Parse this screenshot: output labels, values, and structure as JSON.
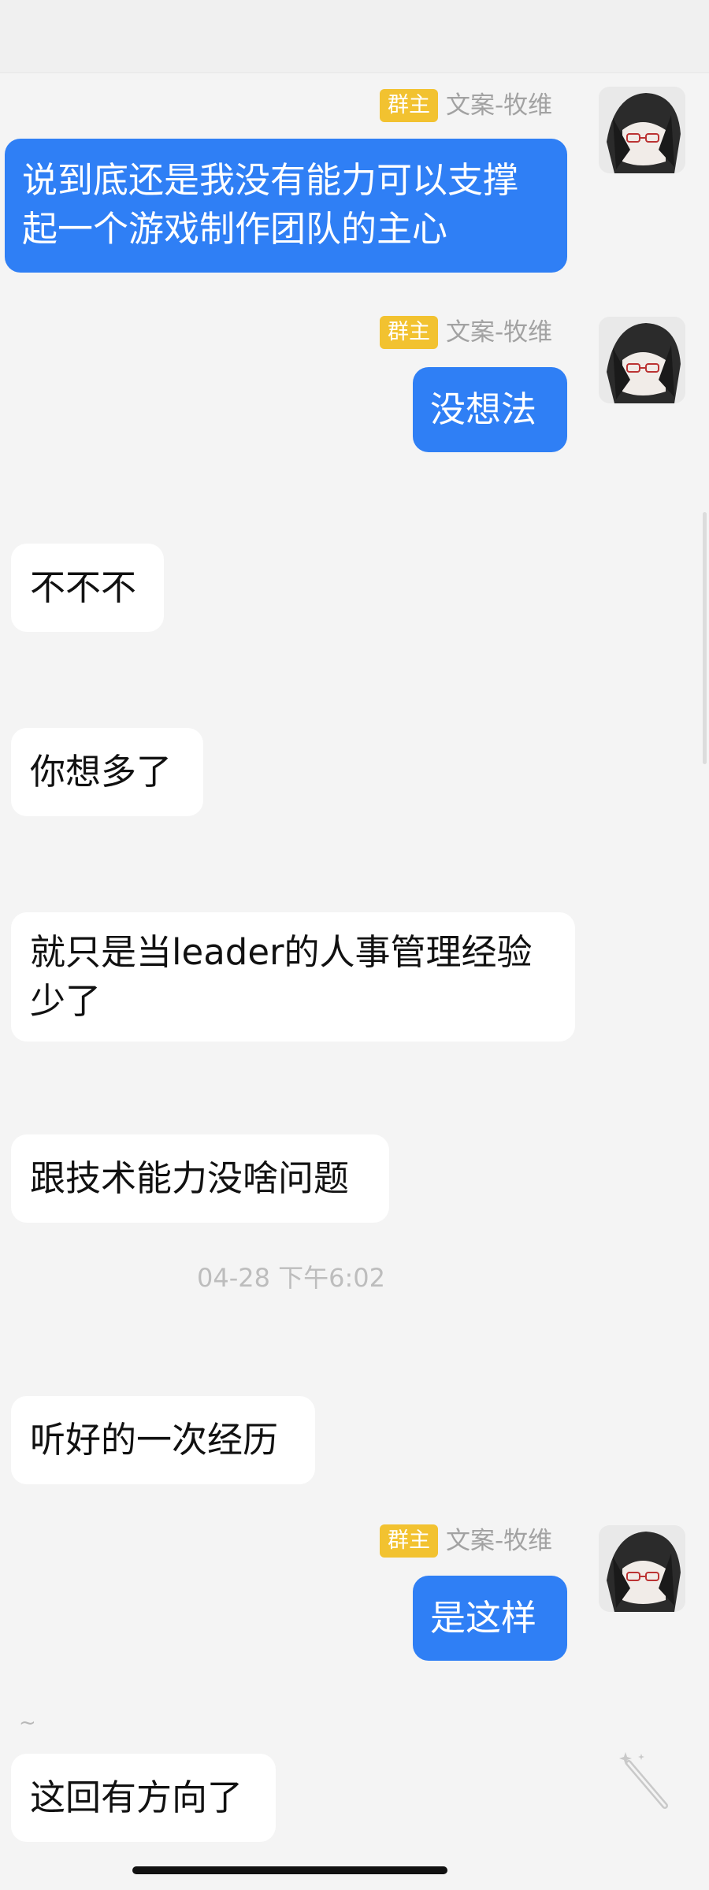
{
  "messages": [
    {
      "badge": "群主",
      "sender": "文案-牧维",
      "text_lines": [
        "说到底还是我没有能力可以支撑",
        "起一个游戏制作团队的主心"
      ]
    },
    {
      "badge": "群主",
      "sender": "文案-牧维",
      "text": "没想法"
    },
    {
      "text": "不不不"
    },
    {
      "text": "你想多了"
    },
    {
      "text_lines": [
        "就只是当leader的人事管理经验",
        "少了"
      ]
    },
    {
      "text": "跟技术能力没啥问题"
    },
    {
      "text": "听好的一次经历"
    },
    {
      "badge": "群主",
      "sender": "文案-牧维",
      "text": "是这样"
    },
    {
      "text": "这回有方向了"
    }
  ],
  "timestamp": "04-28 下午6:02",
  "tilde": "~",
  "icons": {
    "avatar": "avatar-image",
    "wand": "magic-wand-icon"
  },
  "colors": {
    "outgoing_bubble": "#2f7ff5",
    "badge": "#f2c230",
    "background": "#f4f4f4"
  }
}
